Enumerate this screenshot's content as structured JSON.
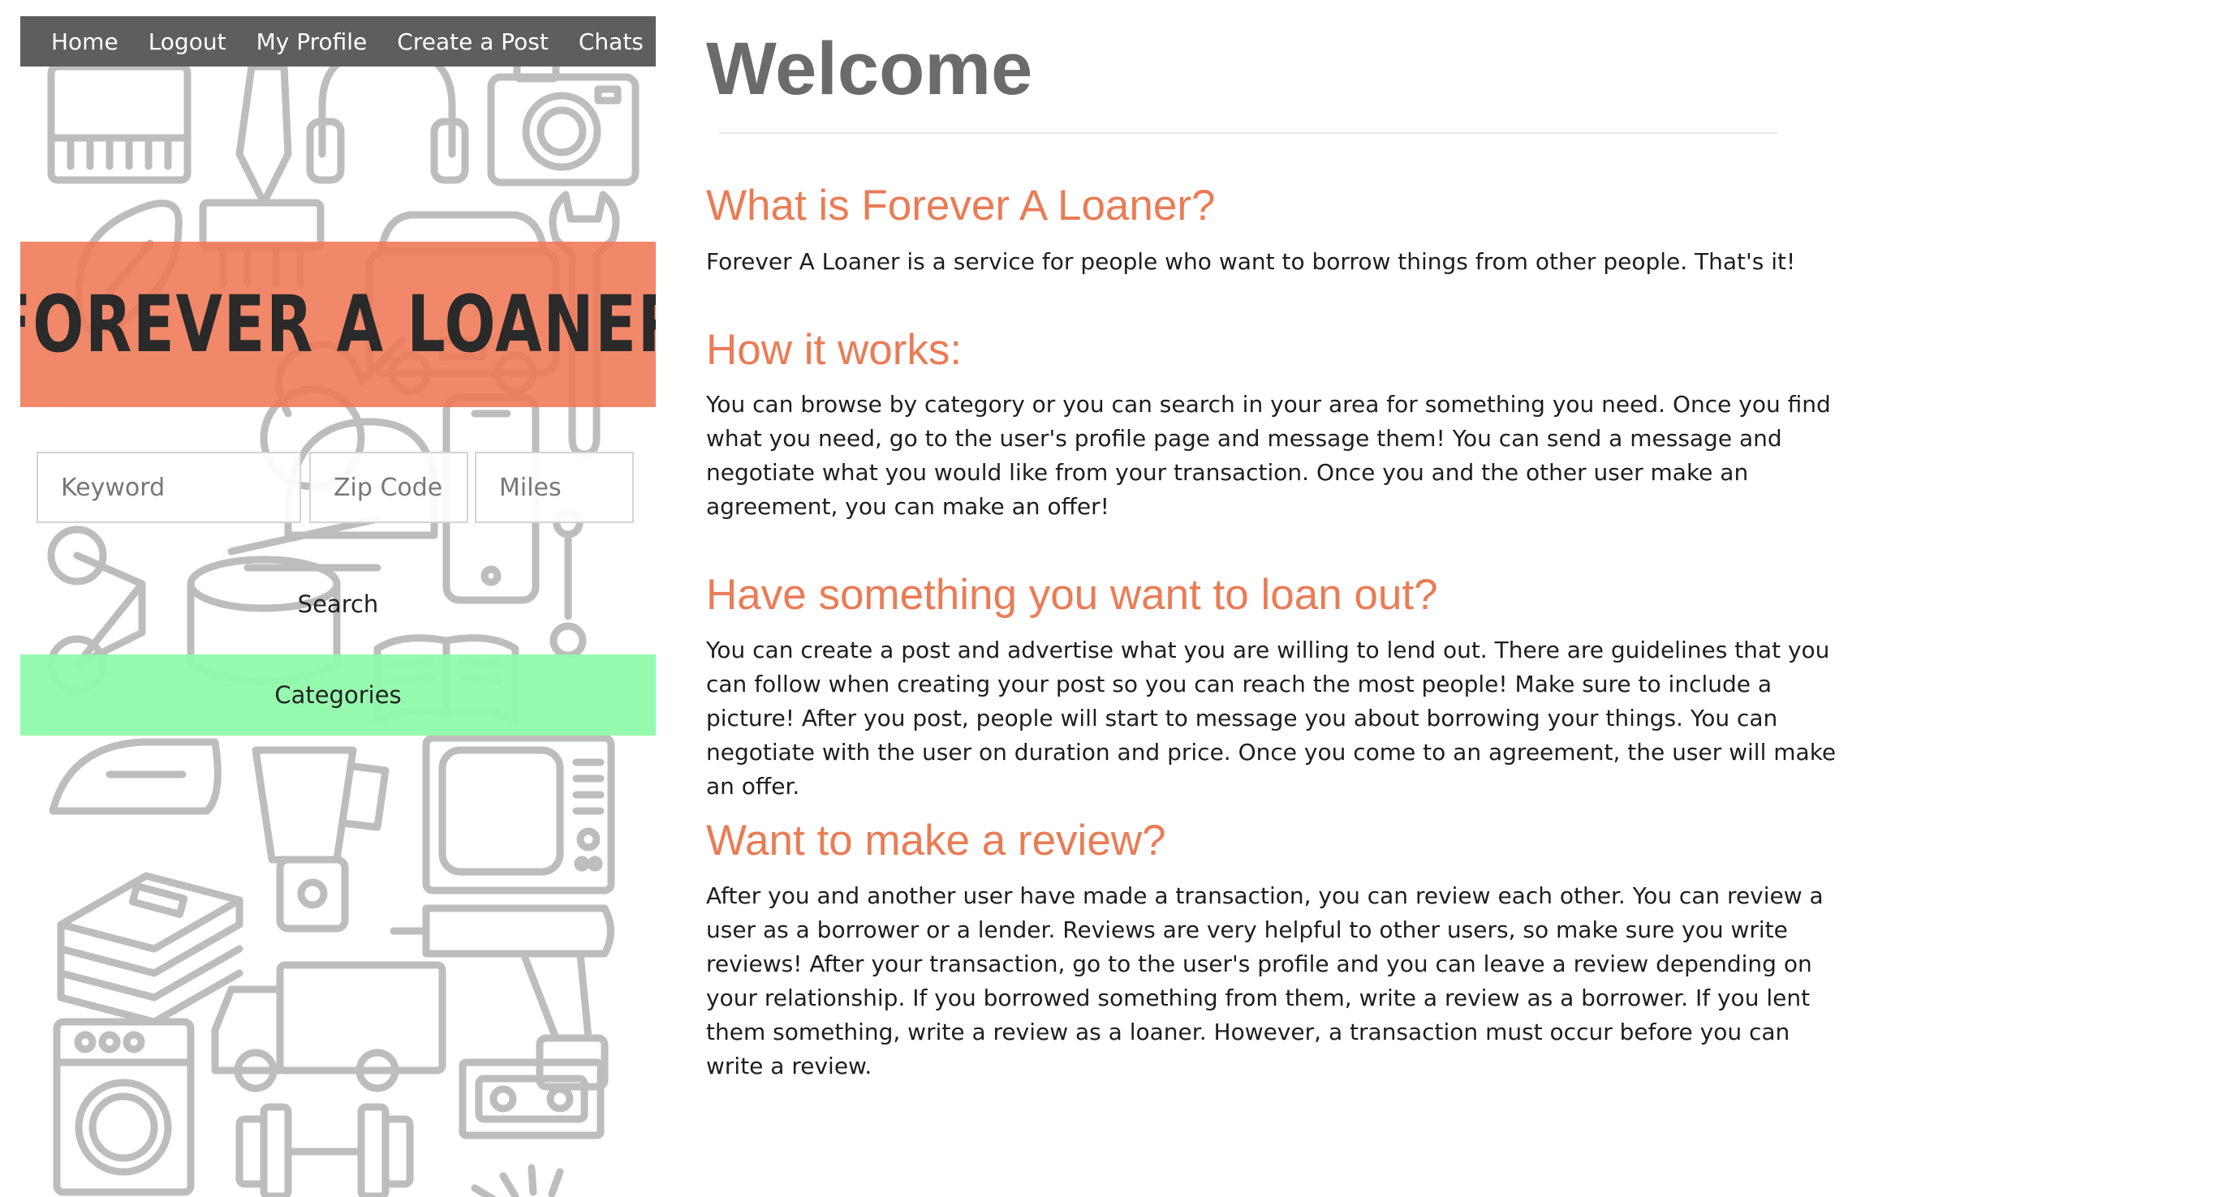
{
  "nav": {
    "items": [
      {
        "label": "Home"
      },
      {
        "label": "Logout"
      },
      {
        "label": "My Profile"
      },
      {
        "label": "Create a Post"
      },
      {
        "label": "Chats"
      }
    ]
  },
  "brand": {
    "title": "FOREVER A LOANER"
  },
  "search": {
    "keyword_placeholder": "Keyword",
    "zip_placeholder": "Zip Code",
    "miles_placeholder": "Miles",
    "button_label": "Search"
  },
  "categories": {
    "label": "Categories"
  },
  "main": {
    "title": "Welcome",
    "sections": [
      {
        "heading": "What is Forever A Loaner?",
        "body": "Forever A Loaner is a service for people who want to borrow things from other people. That's it!"
      },
      {
        "heading": "How it works:",
        "body": "You can browse by category or you can search in your area for something you need. Once you find what you need, go to the user's profile page and message them! You can send a message and negotiate what you would like from your transaction. Once you and the other user make an agreement, you can make an offer!"
      },
      {
        "heading": "Have something you want to loan out?",
        "body": "You can create a post and advertise what you are willing to lend out. There are guidelines that you can follow when creating your post so you can reach the most people! Make sure to include a picture! After you post, people will start to message you about borrowing your things. You can negotiate with the user on duration and price. Once you come to an agreement, the user will make an offer."
      },
      {
        "heading": "Want to make a review?",
        "body": "After you and another user have made a transaction, you can review each other. You can review a user as a borrower or a lender. Reviews are very helpful to other users, so make sure you write reviews! After your transaction, go to the user's profile and you can leave a review depending on your relationship. If you borrowed something from them, write a review as a borrower. If you lent them something, write a review as a loaner. However, a transaction must occur before you can write a review."
      }
    ]
  },
  "colors": {
    "nav_bg": "#5e5e5e",
    "brand_banner": "#ef7854",
    "heading_accent": "#ea7c55",
    "categories_bg": "#90faaa",
    "title_gray": "#6b6b6b"
  },
  "decor_icons": [
    "keyboard-icon",
    "paintbrush-icon",
    "headphones-icon",
    "camera-icon",
    "football-icon",
    "car-icon",
    "wrench-icon",
    "guitar-icon",
    "helmet-icon",
    "phone-icon",
    "bicycle-icon",
    "drum-icon",
    "book-icon",
    "iron-icon",
    "blender-icon",
    "tv-icon",
    "books-stack-icon",
    "drill-icon",
    "truck-icon",
    "washing-machine-icon",
    "dumbbell-icon",
    "vhs-tape-icon",
    "lamp-icon"
  ]
}
